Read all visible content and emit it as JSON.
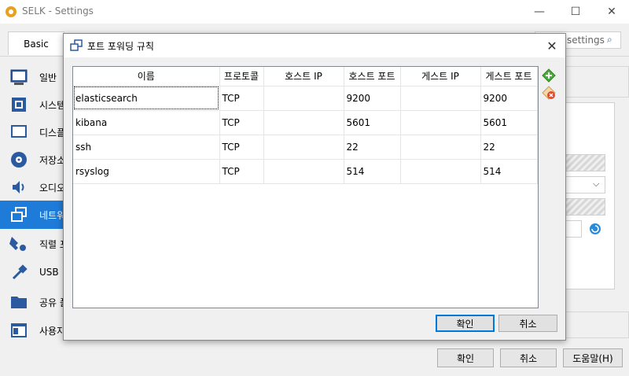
{
  "window": {
    "title": "SELK - Settings",
    "minimize_glyph": "—",
    "maximize_glyph": "☐",
    "close_glyph": "✕"
  },
  "tabs": {
    "basic": "Basic"
  },
  "search": {
    "placeholder": "settings"
  },
  "sidebar": {
    "items": [
      {
        "label": "일반",
        "icon": "general-icon"
      },
      {
        "label": "시스템",
        "icon": "system-icon"
      },
      {
        "label": "디스플레이",
        "icon": "display-icon"
      },
      {
        "label": "저장소",
        "icon": "storage-icon"
      },
      {
        "label": "오디오",
        "icon": "audio-icon"
      },
      {
        "label": "네트워크",
        "icon": "network-icon"
      },
      {
        "label": "직렬 포트",
        "icon": "serial-port-icon"
      },
      {
        "label": "USB",
        "icon": "usb-icon"
      },
      {
        "label": "공유 폴더",
        "icon": "shared-folder-icon"
      },
      {
        "label": "사용자 인터페이스",
        "icon": "user-interface-icon"
      }
    ],
    "active_index": 5
  },
  "footer": {
    "ok": "확인",
    "cancel": "취소",
    "help": "도움말(H)"
  },
  "dialog": {
    "title": "포트 포워딩 규칙",
    "close_glyph": "✕",
    "columns": [
      "이름",
      "프로토콜",
      "호스트 IP",
      "호스트 포트",
      "게스트 IP",
      "게스트 포트"
    ],
    "rows": [
      [
        "elasticsearch",
        "TCP",
        "",
        "9200",
        "",
        "9200"
      ],
      [
        "kibana",
        "TCP",
        "",
        "5601",
        "",
        "5601"
      ],
      [
        "ssh",
        "TCP",
        "",
        "22",
        "",
        "22"
      ],
      [
        "rsyslog",
        "TCP",
        "",
        "514",
        "",
        "514"
      ]
    ],
    "selected_cell": {
      "row": 0,
      "col": 0
    },
    "ok": "확인",
    "cancel": "취소"
  },
  "colors": {
    "accent": "#1f7bd8",
    "add_rule": "#4caf3a",
    "remove_rule": "#e04a2a"
  }
}
